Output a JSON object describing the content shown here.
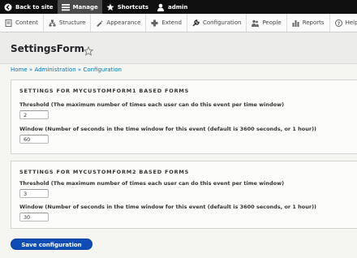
{
  "toolbar": {
    "back_label": "Back to site",
    "manage_label": "Manage",
    "shortcuts_label": "Shortcuts",
    "user_label": "admin"
  },
  "tray": {
    "items": [
      {
        "label": "Content",
        "icon": "content-icon"
      },
      {
        "label": "Structure",
        "icon": "structure-icon"
      },
      {
        "label": "Appearance",
        "icon": "appearance-icon"
      },
      {
        "label": "Extend",
        "icon": "extend-icon"
      },
      {
        "label": "Configuration",
        "icon": "wrench-icon"
      },
      {
        "label": "People",
        "icon": "people-icon"
      },
      {
        "label": "Reports",
        "icon": "reports-icon"
      },
      {
        "label": "Help",
        "icon": "help-icon"
      }
    ]
  },
  "page": {
    "title": "SettingsForm",
    "breadcrumb": [
      "Home",
      "Administration",
      "Configuration"
    ],
    "breadcrumb_sep": "»"
  },
  "forms": [
    {
      "legend": "SETTINGS FOR MYCUSTOMFORM1 BASED FORMS",
      "threshold_label": "Threshold (The maximum number of times each user can do this event per time window)",
      "threshold_value": "2",
      "window_label": "Window (Number of seconds in the time window for this event (default is 3600 seconds, or 1 hour))",
      "window_value": "60"
    },
    {
      "legend": "SETTINGS FOR MYCUSTOMFORM2 BASED FORMS",
      "threshold_label": "Threshold (The maximum number of times each user can do this event per time window)",
      "threshold_value": "3",
      "window_label": "Window (Number of seconds in the time window for this event (default is 3600 seconds, or 1 hour))",
      "window_value": "30"
    }
  ],
  "actions": {
    "save_label": "Save configuration"
  },
  "colors": {
    "toolbar_bg": "#0f0f0f",
    "link": "#0074bd",
    "primary_button": "#0f4db5"
  }
}
